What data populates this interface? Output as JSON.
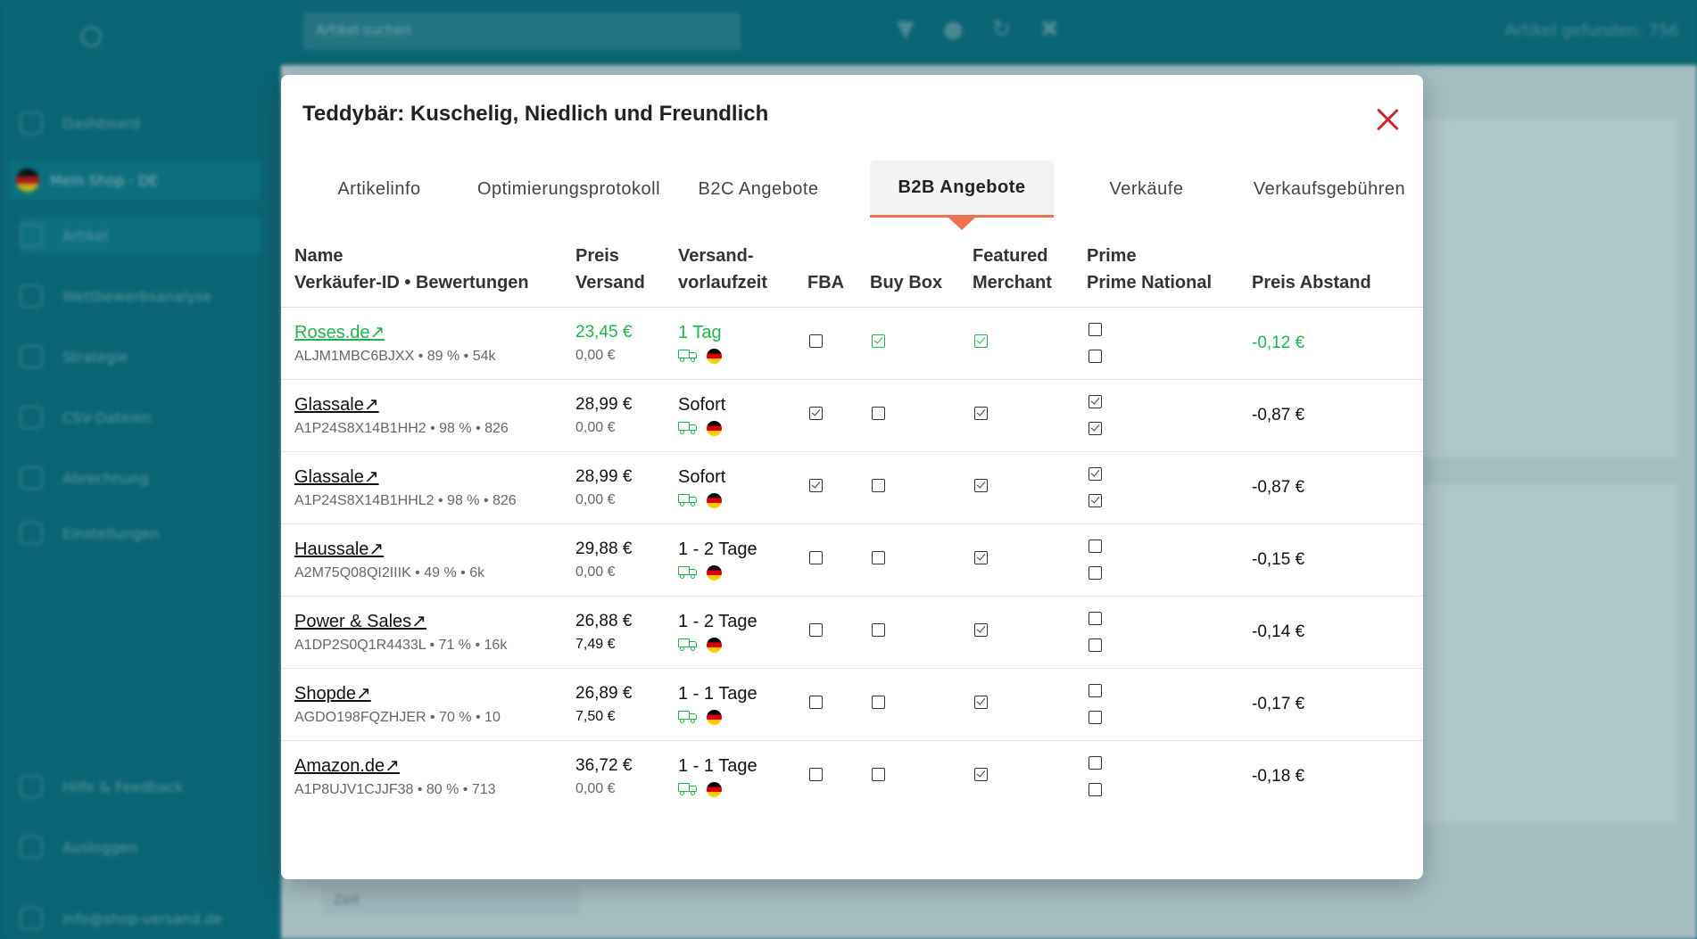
{
  "background": {
    "search_placeholder": "Artikel suchen",
    "top_right": "Artikel gefunden: 756",
    "shop_selector": "Mein Shop · DE",
    "nav": [
      "Dashboard",
      "Artikel",
      "Wettbewerbsanalyse",
      "Strategie",
      "CSV-Dateien",
      "Abrechnung",
      "Einstellungen",
      "Hilfe & Feedback",
      "Ausloggen"
    ],
    "footer_select": "Zeit",
    "user": "info@shop-versand.de"
  },
  "modal": {
    "title": "Teddybär: Kuschelig, Niedlich und Freundlich",
    "tabs": [
      {
        "label": "Artikelinfo",
        "active": false
      },
      {
        "label": "Optimierungsprotokoll",
        "active": false
      },
      {
        "label": "B2C Angebote",
        "active": false
      },
      {
        "label": "B2B Angebote",
        "active": true
      },
      {
        "label": "Verkäufe",
        "active": false
      },
      {
        "label": "Verkaufsgebühren",
        "active": false
      }
    ],
    "table": {
      "headers": {
        "name": "Name",
        "seller": "Verkäufer-ID • Bewertungen",
        "price": "Preis",
        "shipping": "Versand",
        "delivery_1": "Versand-",
        "delivery_2": "vorlaufzeit",
        "fba": "FBA",
        "buybox": "Buy Box",
        "featured_1": "Featured",
        "featured_2": "Merchant",
        "prime_1": "Prime",
        "prime_2": "Prime National",
        "diff": "Preis Abstand"
      },
      "rows": [
        {
          "name": "Roses.de↗",
          "sub": "ALJM1MBC6BJXX • 89 % • 54k",
          "price": "23,45 €",
          "shipping": "0,00 €",
          "delivery": "1 Tag",
          "fba": false,
          "buybox": true,
          "featured": true,
          "prime": false,
          "prime_national": false,
          "diff": "-0,12 €",
          "highlight": true
        },
        {
          "name": "Glassale↗",
          "sub": "A1P24S8X14B1HH2 • 98 % • 826",
          "price": "28,99 €",
          "shipping": "0,00 €",
          "delivery": "Sofort",
          "fba": true,
          "buybox": false,
          "featured": true,
          "prime": true,
          "prime_national": true,
          "diff": "-0,87 €",
          "highlight": false
        },
        {
          "name": "Glassale↗",
          "sub": "A1P24S8X14B1HHL2 • 98 % • 826",
          "price": "28,99 €",
          "shipping": "0,00 €",
          "delivery": "Sofort",
          "fba": true,
          "buybox": false,
          "featured": true,
          "prime": true,
          "prime_national": true,
          "diff": "-0,87 €",
          "highlight": false
        },
        {
          "name": "Haussale↗",
          "sub": "A2M75Q08QI2IIIK • 49 % • 6k",
          "price": "29,88 €",
          "shipping": "0,00 €",
          "delivery": "1 - 2 Tage",
          "fba": false,
          "buybox": false,
          "featured": true,
          "prime": false,
          "prime_national": false,
          "diff": "-0,15 €",
          "highlight": false
        },
        {
          "name": "Power & Sales↗",
          "sub": "A1DP2S0Q1R4433L • 71 % • 16k",
          "price": "26,88 €",
          "shipping": "7,49 €",
          "delivery": "1 - 2 Tage",
          "fba": false,
          "buybox": false,
          "featured": true,
          "prime": false,
          "prime_national": false,
          "diff": "-0,14 €",
          "highlight": false
        },
        {
          "name": "Shopde↗",
          "sub": "AGDO198FQZHJER • 70 % • 10",
          "price": "26,89 €",
          "shipping": "7,50 €",
          "delivery": "1 - 1 Tage",
          "fba": false,
          "buybox": false,
          "featured": true,
          "prime": false,
          "prime_national": false,
          "diff": "-0,17 €",
          "highlight": false
        },
        {
          "name": "Amazon.de↗",
          "sub": "A1P8UJV1CJJF38 • 80 % • 713",
          "price": "36,72 €",
          "shipping": "0,00 €",
          "delivery": "1 - 1 Tage",
          "fba": false,
          "buybox": false,
          "featured": true,
          "prime": false,
          "prime_national": false,
          "diff": "-0,18 €",
          "highlight": false
        }
      ]
    }
  },
  "colors": {
    "accent": "#f07050",
    "green": "#21b34c",
    "close": "#c62b2b",
    "teal": "#0b6470"
  }
}
